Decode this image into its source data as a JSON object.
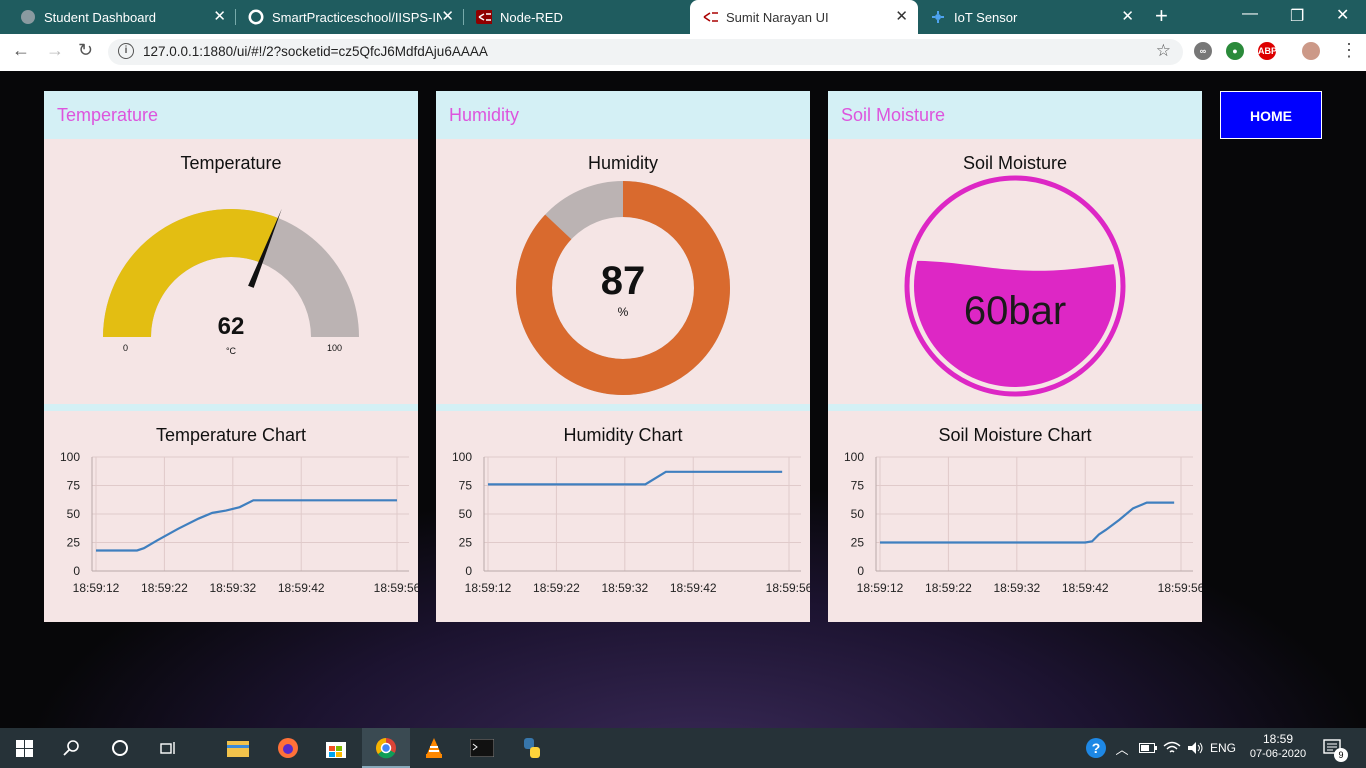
{
  "browser": {
    "tabs": [
      {
        "title": "Student Dashboard",
        "icon": "globe-icon"
      },
      {
        "title": "SmartPracticeschool/IISPS-INT",
        "icon": "github-icon"
      },
      {
        "title": "Node-RED",
        "icon": "node-red-icon"
      },
      {
        "title": "Sumit Narayan UI",
        "icon": "node-red-icon"
      },
      {
        "title": "IoT Sensor",
        "icon": "iot-icon"
      }
    ],
    "active_tab": 3,
    "url": "127.0.0.1:1880/ui/#!/2?socketid=cz5QfcJ6MdfdAju6AAAA",
    "extensions": {
      "adblock": "ABP"
    }
  },
  "dashboard": {
    "home_button": "HOME",
    "temperature": {
      "group_title": "Temperature",
      "gauge_title": "Temperature",
      "value": "62",
      "value_num": 62,
      "unit": "°C",
      "min": "0",
      "max": "100",
      "chart_title": "Temperature Chart"
    },
    "humidity": {
      "group_title": "Humidity",
      "gauge_title": "Humidity",
      "value": "87",
      "value_num": 87,
      "unit": "%",
      "chart_title": "Humidity Chart"
    },
    "soil": {
      "group_title": "Soil Moisture",
      "gauge_title": "Soil Moisture",
      "value": "60bar",
      "level": 0.6,
      "chart_title": "Soil Moisture Chart"
    }
  },
  "chart_data": [
    {
      "type": "line",
      "title": "Temperature Chart",
      "ylim": [
        0,
        100
      ],
      "yticks": [
        "100",
        "75",
        "50",
        "25",
        "0"
      ],
      "xticks": [
        "18:59:12",
        "18:59:22",
        "18:59:32",
        "18:59:42",
        "18:59:56"
      ],
      "xtick_seconds": [
        12,
        22,
        32,
        42,
        56
      ],
      "series": [
        {
          "x": [
            12,
            15,
            18,
            19,
            21,
            24,
            27,
            29,
            31,
            33,
            35,
            38,
            56
          ],
          "y": [
            18,
            18,
            18,
            20,
            27,
            37,
            46,
            51,
            53,
            56,
            62,
            62,
            62
          ]
        }
      ]
    },
    {
      "type": "line",
      "title": "Humidity Chart",
      "ylim": [
        0,
        100
      ],
      "yticks": [
        "100",
        "75",
        "50",
        "25",
        "0"
      ],
      "xticks": [
        "18:59:12",
        "18:59:22",
        "18:59:32",
        "18:59:42",
        "18:59:56"
      ],
      "xtick_seconds": [
        12,
        22,
        32,
        42,
        56
      ],
      "series": [
        {
          "x": [
            12,
            20,
            30,
            35,
            38,
            45,
            55
          ],
          "y": [
            76,
            76,
            76,
            76,
            87,
            87,
            87
          ]
        }
      ]
    },
    {
      "type": "line",
      "title": "Soil Moisture Chart",
      "ylim": [
        0,
        100
      ],
      "yticks": [
        "100",
        "75",
        "50",
        "25",
        "0"
      ],
      "xticks": [
        "18:59:12",
        "18:59:22",
        "18:59:32",
        "18:59:42",
        "18:59:56"
      ],
      "xtick_seconds": [
        12,
        22,
        32,
        42,
        56
      ],
      "series": [
        {
          "x": [
            12,
            22,
            32,
            42,
            43,
            44,
            45,
            47,
            49,
            51,
            53,
            55
          ],
          "y": [
            25,
            25,
            25,
            25,
            26,
            32,
            36,
            45,
            55,
            60,
            60,
            60
          ]
        }
      ]
    }
  ],
  "colors": {
    "temp_gauge": "#e3be12",
    "humidity_gauge": "#d96a2e",
    "soil_fill": "#dd27c5",
    "gauge_bg": "#bbb3b3",
    "line": "#3f7fbf",
    "tabbar": "#1f5c5f"
  },
  "taskbar": {
    "time": "18:59",
    "date": "07-06-2020",
    "lang": "ENG",
    "notifications": "9"
  }
}
